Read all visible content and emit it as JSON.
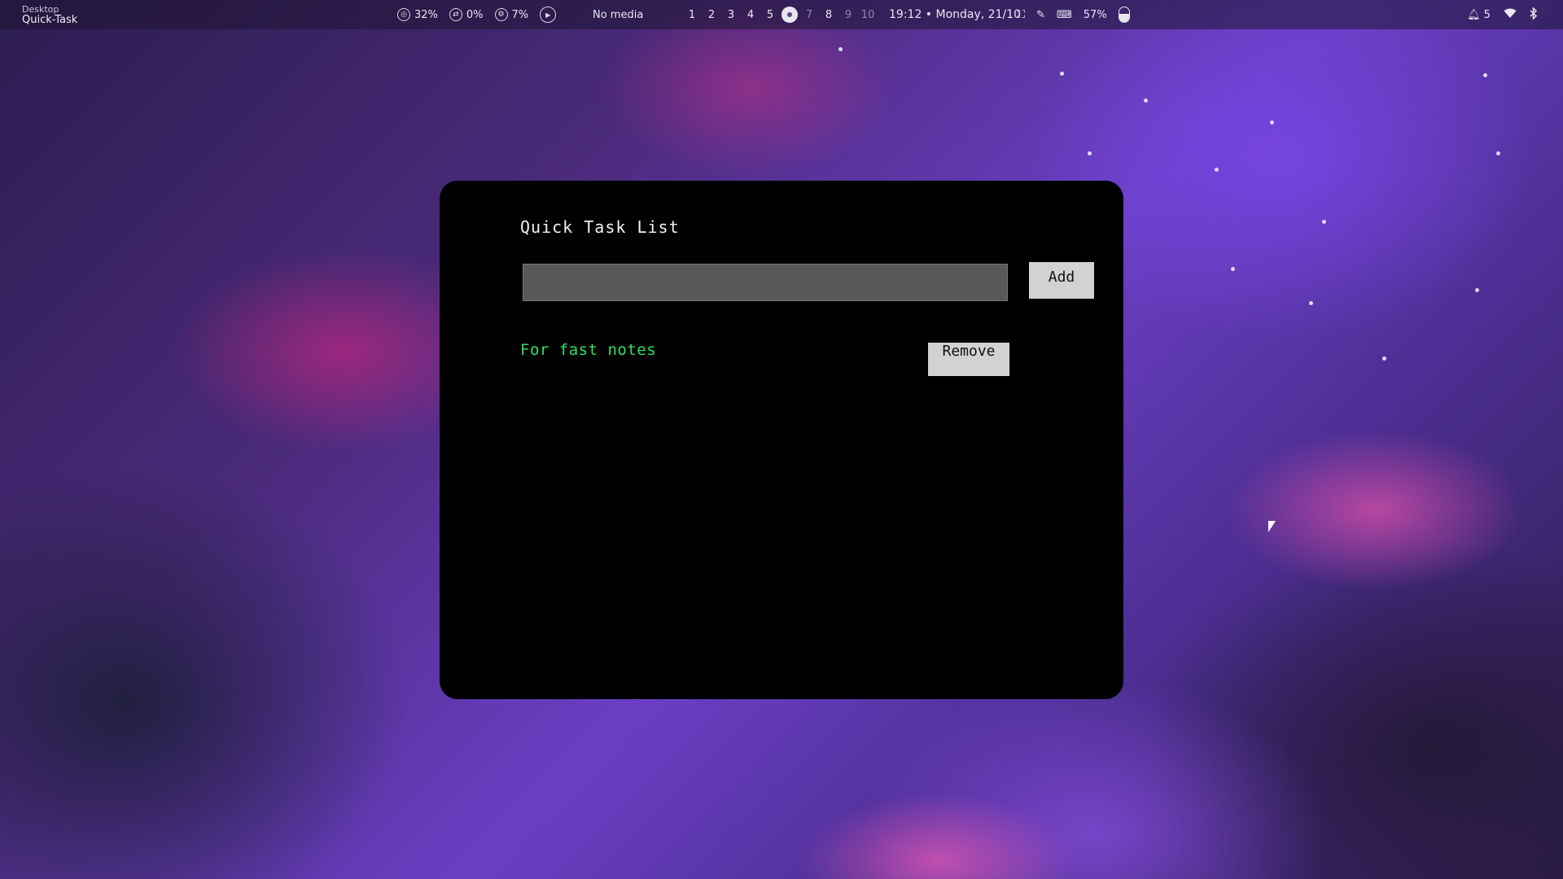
{
  "topbar": {
    "window_class": "Desktop",
    "window_title": "Quick-Task",
    "cpu": {
      "icon": "cpu-icon",
      "value": "32%"
    },
    "swap": {
      "icon": "swap-icon",
      "value": "0%"
    },
    "gpu": {
      "icon": "gpu-icon",
      "value": "7%"
    },
    "media": {
      "icon": "play-icon",
      "label": "No media"
    },
    "workspaces": {
      "items": [
        "1",
        "2",
        "3",
        "4",
        "5",
        "",
        "7",
        "8",
        "9",
        "10"
      ],
      "active_index": 5
    },
    "clock": "19:12 • Monday, 21/10",
    "utilities": {
      "screenshot_icon": "fullscreen-icon",
      "color_picker_icon": "color-picker-icon",
      "keyboard_icon": "keyboard-icon"
    },
    "battery": {
      "label": "57%",
      "level": 0.57
    },
    "notifications": {
      "icon": "bell-icon",
      "count": "5"
    },
    "wifi_icon": "wifi-icon",
    "bluetooth_icon": "bluetooth-icon"
  },
  "app": {
    "title": "Quick Task List",
    "input": {
      "value": "",
      "placeholder": ""
    },
    "add_label": "Add",
    "tasks": [
      {
        "text": "For fast notes",
        "remove_label": "Remove"
      }
    ]
  },
  "colors": {
    "task_text": "#2fe35a",
    "button_bg": "#d2d2d2",
    "input_bg": "#595959",
    "window_bg": "#000000"
  }
}
